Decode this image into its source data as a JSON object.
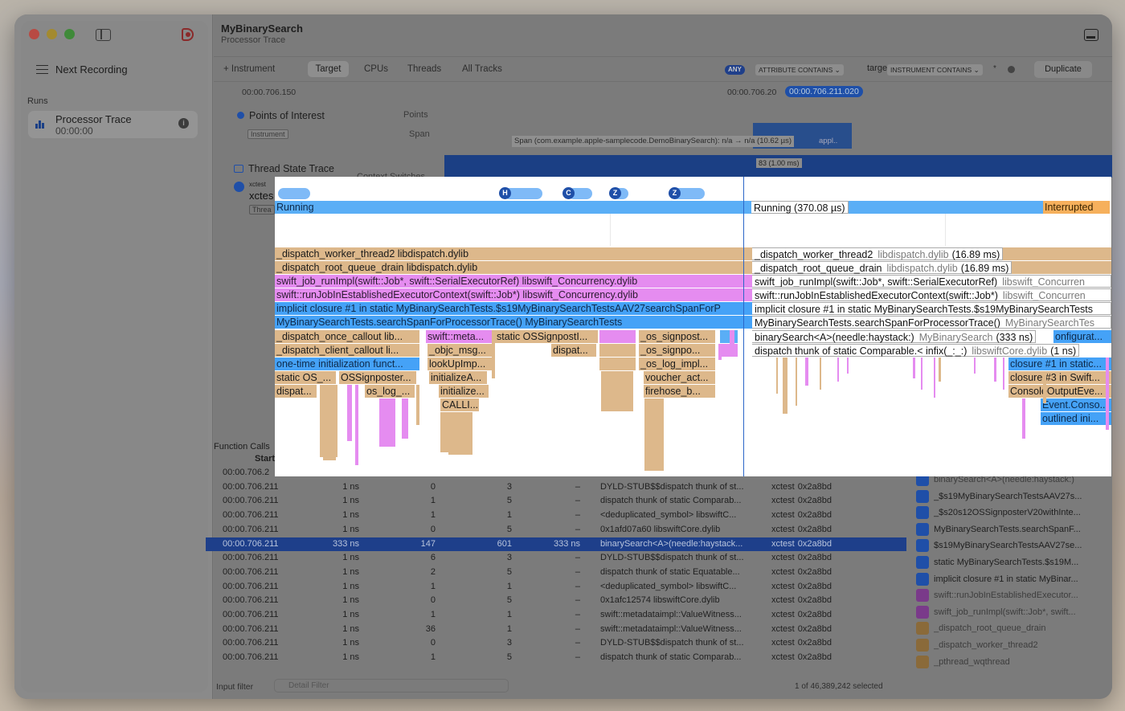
{
  "window": {
    "title": "MyBinarySearch",
    "subtitle": "Processor Trace"
  },
  "sidebar": {
    "next_recording": "Next Recording",
    "runs_label": "Runs",
    "run": {
      "title": "Processor Trace",
      "time": "00:00:00"
    }
  },
  "toolbar": {
    "instrument": "+ Instrument",
    "tabs": [
      "Target",
      "CPUs",
      "Threads",
      "All Tracks"
    ],
    "any": "ANY",
    "attr": "ATTRIBUTE CONTAINS ⌄",
    "target": "target",
    "inst_contains": "INSTRUMENT CONTAINS ⌄",
    "star": "*",
    "duplicate": "Duplicate"
  },
  "ruler": {
    "left": "00:00.706.150",
    "mid": "00:00.706.20",
    "selected": "00:00.706.211.020"
  },
  "tracks": {
    "poi": "Points of Interest",
    "instrument_tag": "Instrument",
    "points": "Points",
    "span": "Span",
    "span_text": "Span (com.example.apple-samplecode.DemoBinarySearch): n/a → n/a (10.62 µs)",
    "span_appl": "appl..",
    "thread_state": "Thread State Trace",
    "context_switches": "Context Switches",
    "cs_value": "83 (1.00 ms)",
    "xctest_small": "xctest",
    "xctest_big": "xctes",
    "thread_tag": "Threa"
  },
  "function_calls": {
    "label": "Function Calls",
    "start_header": "Start",
    "rows": [
      {
        "start": "00:00.706.2",
        "dur": "",
        "a": "",
        "b": "",
        "c": "",
        "sym": "",
        "lib": "",
        "lib2": ""
      },
      {
        "start": "00:00.706.211",
        "dur": "1 ns",
        "a": "0",
        "b": "3",
        "c": "–",
        "sym": "DYLD-STUB$$dispatch thunk of st...",
        "lib": "xctest",
        "lib2": "0x2a8bd"
      },
      {
        "start": "00:00.706.211",
        "dur": "1 ns",
        "a": "1",
        "b": "5",
        "c": "–",
        "sym": "dispatch thunk of static Comparab...",
        "lib": "xctest",
        "lib2": "0x2a8bd"
      },
      {
        "start": "00:00.706.211",
        "dur": "1 ns",
        "a": "1",
        "b": "1",
        "c": "–",
        "sym": "<deduplicated_symbol> libswiftC...",
        "lib": "xctest",
        "lib2": "0x2a8bd"
      },
      {
        "start": "00:00.706.211",
        "dur": "1 ns",
        "a": "0",
        "b": "5",
        "c": "–",
        "sym": "0x1afd07a60 libswiftCore.dylib",
        "lib": "xctest",
        "lib2": "0x2a8bd"
      },
      {
        "start": "00:00.706.211",
        "dur": "333 ns",
        "a": "147",
        "b": "601",
        "c": "333 ns",
        "sym": "binarySearch<A>(needle:haystack...",
        "lib": "xctest",
        "lib2": "0x2a8bd"
      },
      {
        "start": "00:00.706.211",
        "dur": "1 ns",
        "a": "6",
        "b": "3",
        "c": "–",
        "sym": "DYLD-STUB$$dispatch thunk of st...",
        "lib": "xctest",
        "lib2": "0x2a8bd"
      },
      {
        "start": "00:00.706.211",
        "dur": "1 ns",
        "a": "2",
        "b": "5",
        "c": "–",
        "sym": "dispatch thunk of static Equatable...",
        "lib": "xctest",
        "lib2": "0x2a8bd"
      },
      {
        "start": "00:00.706.211",
        "dur": "1 ns",
        "a": "1",
        "b": "1",
        "c": "–",
        "sym": "<deduplicated_symbol> libswiftC...",
        "lib": "xctest",
        "lib2": "0x2a8bd"
      },
      {
        "start": "00:00.706.211",
        "dur": "1 ns",
        "a": "0",
        "b": "5",
        "c": "–",
        "sym": "0x1afc12574 libswiftCore.dylib",
        "lib": "xctest",
        "lib2": "0x2a8bd"
      },
      {
        "start": "00:00.706.211",
        "dur": "1 ns",
        "a": "1",
        "b": "1",
        "c": "–",
        "sym": "swift::metadataimpl::ValueWitness...",
        "lib": "xctest",
        "lib2": "0x2a8bd"
      },
      {
        "start": "00:00.706.211",
        "dur": "1 ns",
        "a": "36",
        "b": "1",
        "c": "–",
        "sym": "swift::metadataimpl::ValueWitness...",
        "lib": "xctest",
        "lib2": "0x2a8bd"
      },
      {
        "start": "00:00.706.211",
        "dur": "1 ns",
        "a": "0",
        "b": "3",
        "c": "–",
        "sym": "DYLD-STUB$$dispatch thunk of st...",
        "lib": "xctest",
        "lib2": "0x2a8bd"
      },
      {
        "start": "00:00.706.211",
        "dur": "1 ns",
        "a": "1",
        "b": "5",
        "c": "–",
        "sym": "dispatch thunk of static Comparab...",
        "lib": "xctest",
        "lib2": "0x2a8bd"
      }
    ]
  },
  "stack": [
    {
      "label": "binarySearch<A>(needle:haystack:)",
      "icon": "person-icon"
    },
    {
      "label": "_$s19MyBinarySearchTestsAAV27s...",
      "icon": "person-icon"
    },
    {
      "label": "_$s20s12OSSignposterV20withInte...",
      "icon": "person-icon"
    },
    {
      "label": "MyBinarySearchTests.searchSpanF...",
      "icon": "person-icon"
    },
    {
      "label": "$s19MyBinarySearchTestsAAV27se...",
      "icon": "person-icon"
    },
    {
      "label": "static MyBinarySearchTests.$s19M...",
      "icon": "person-icon"
    },
    {
      "label": "implicit closure #1 in static MyBinar...",
      "icon": "person-icon"
    },
    {
      "label": "swift::runJobInEstablishedExecutor...",
      "icon": "code-icon"
    },
    {
      "label": "swift_job_runImpl(swift::Job*, swift...",
      "icon": "code-icon"
    },
    {
      "label": "_dispatch_root_queue_drain",
      "icon": "building-icon"
    },
    {
      "label": "_dispatch_worker_thread2",
      "icon": "building-icon"
    },
    {
      "label": "_pthread_wqthread",
      "icon": "building-icon"
    }
  ],
  "footer": {
    "input_filter": "Input filter",
    "detail_filter": "Detail Filter",
    "selected": "1 of 46,389,242 selected"
  },
  "popup": {
    "badges": [
      "H",
      "C",
      "Z",
      "Z"
    ],
    "running_left": "Running",
    "running_right": "Running (370.08 µs)",
    "interrupted": "Interrupted",
    "left_rows": [
      "_dispatch_worker_thread2  libdispatch.dylib",
      "_dispatch_root_queue_drain  libdispatch.dylib",
      "swift_job_runImpl(swift::Job*, swift::SerialExecutorRef)  libswift_Concurrency.dylib",
      "swift::runJobInEstablishedExecutorContext(swift::Job*)  libswift_Concurrency.dylib",
      "implicit closure #1 in static MyBinarySearchTests.$s19MyBinarySearchTestsAAV27searchSpanForP",
      "MyBinarySearchTests.searchSpanForProcessorTrace()  MyBinarySearchTests"
    ],
    "right_rows": [
      {
        "name": "_dispatch_worker_thread2",
        "lib": "libdispatch.dylib",
        "dur": "(16.89 ms)"
      },
      {
        "name": "_dispatch_root_queue_drain",
        "lib": "libdispatch.dylib",
        "dur": "(16.89 ms)"
      },
      {
        "name": "swift_job_runImpl(swift::Job*, swift::SerialExecutorRef)",
        "lib": "libswift_Concurren",
        "dur": ""
      },
      {
        "name": "swift::runJobInEstablishedExecutorContext(swift::Job*)",
        "lib": "libswift_Concurren",
        "dur": ""
      },
      {
        "name": "implicit closure #1 in static MyBinarySearchTests.$s19MyBinarySearchTests",
        "lib": "",
        "dur": ""
      },
      {
        "name": "MyBinarySearchTests.searchSpanForProcessorTrace()",
        "lib": "MyBinarySearchTes",
        "dur": ""
      },
      {
        "name": "binarySearch<A>(needle:haystack:)",
        "lib": "MyBinarySearch",
        "dur": "(333 ns)"
      },
      {
        "name": "dispatch thunk of static Comparable.< infix(_:_:)",
        "lib": "libswiftCore.dylib",
        "dur": "(1 ns)"
      }
    ],
    "small_blocks": [
      "_dispatch_once_callout  lib...",
      "swift::meta...",
      "static OSSignpostI...",
      "_os_signpost...",
      "_dispatch_client_callout  li...",
      "_objc_msg...",
      "dispat...",
      "_os_signpo...",
      "one-time initialization funct...",
      "lookUpImp...",
      "_os_log_impl...",
      "static OS_...",
      "OSSignposter...",
      "initializeA...",
      "voucher_act...",
      "dispat...",
      "os_log_...",
      "initialize...",
      "firehose_b...",
      "CALLI...",
      "onfigurat...",
      "closure #1 in static...",
      "closure #3 in Swift...",
      "ConsoleOutputEve...",
      "Event.Conso...",
      "outlined ini..."
    ]
  }
}
